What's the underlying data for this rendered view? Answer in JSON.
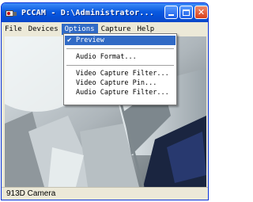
{
  "window": {
    "title": "PCCAM - D:\\Administrator...",
    "icon": "webcam-icon"
  },
  "menubar": {
    "items": [
      "File",
      "Devices",
      "Options",
      "Capture",
      "Help"
    ],
    "open": "Options"
  },
  "options_menu": {
    "items": [
      {
        "label": "Preview",
        "checked": true,
        "selected": true
      },
      {
        "separator": true
      },
      {
        "label": "Audio Format..."
      },
      {
        "separator": true
      },
      {
        "label": "Video Capture Filter..."
      },
      {
        "label": "Video Capture Pin..."
      },
      {
        "label": "Audio Capture Filter..."
      }
    ]
  },
  "statusbar": {
    "text": "913D Camera"
  },
  "colors": {
    "titlebar": "#0a5ae0",
    "menu_highlight": "#316ac5",
    "close_button": "#d8401c",
    "window_face": "#ece9d8"
  }
}
